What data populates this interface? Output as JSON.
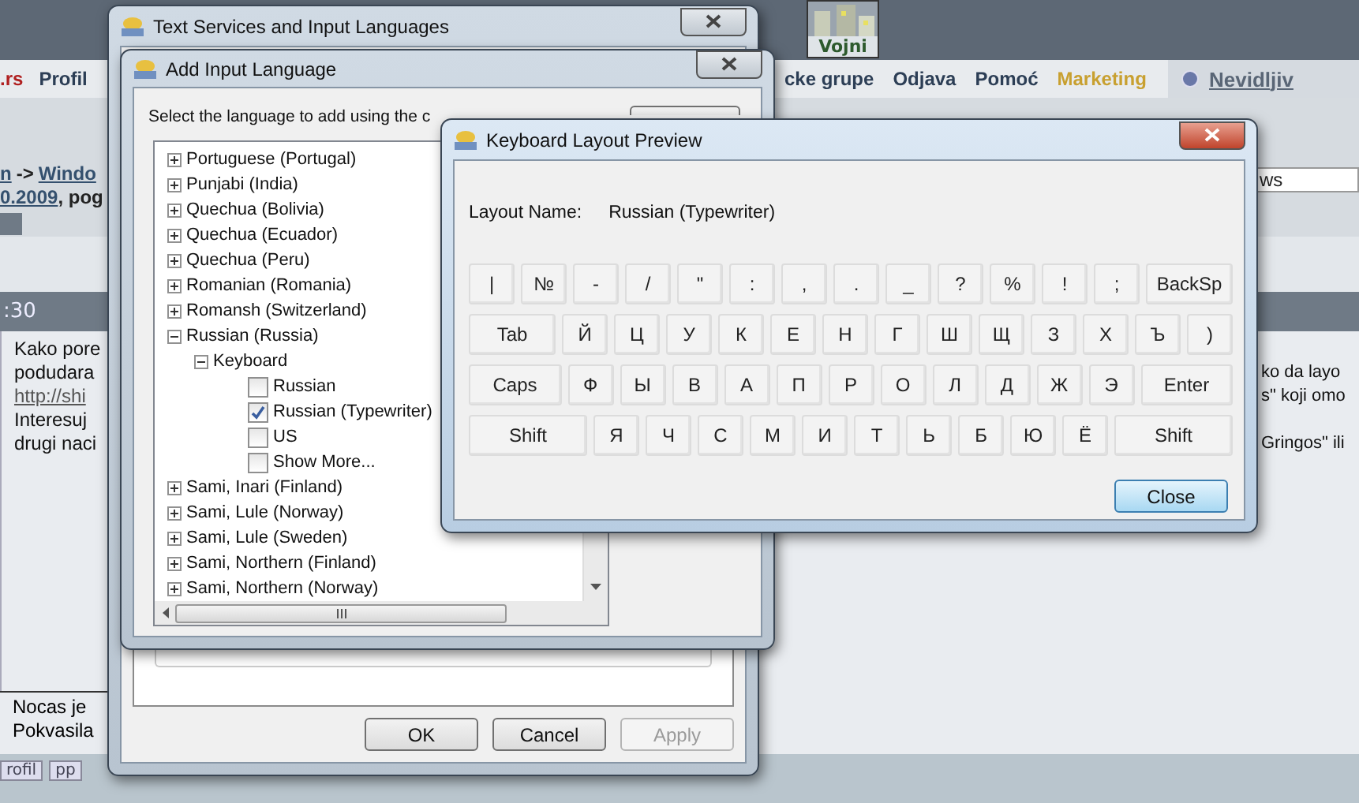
{
  "background_page": {
    "top_tab": {
      "label": "Vojni"
    },
    "nav": [
      {
        "label": ".rs",
        "kind": "brand"
      },
      {
        "label": "Profil",
        "kind": "link"
      },
      {
        "label": "cke grupe",
        "kind": "link"
      },
      {
        "label": "Odjava",
        "kind": "link"
      },
      {
        "label": "Pomoć",
        "kind": "link"
      },
      {
        "label": "Marketing",
        "kind": "highlight"
      }
    ],
    "user_status": "Nevidljiv",
    "breadcrumb": [
      {
        "text": "n",
        "kind": "link"
      },
      {
        "text": "->",
        "kind": "text"
      },
      {
        "text": "Windo",
        "kind": "link"
      }
    ],
    "date_line": [
      {
        "text": "0.2009",
        "kind": "link"
      },
      {
        "text": ", pog",
        "kind": "text"
      }
    ],
    "search_value": "ws",
    "post_time": ":30",
    "post_left": [
      {
        "text": "Kako pore",
        "kind": "text"
      },
      {
        "text": "podudara",
        "kind": "text"
      },
      {
        "text": "http://shi",
        "kind": "link"
      },
      {
        "text": "Interesuj",
        "kind": "text"
      },
      {
        "text": "drugi naci",
        "kind": "text"
      }
    ],
    "post_right_paragraphs": [
      [
        "ko da layo",
        "s\" koji omo"
      ],
      [
        "Gringos\" ili"
      ]
    ],
    "signature": [
      "Nocas je",
      "Pokvasila"
    ],
    "footer_buttons": [
      "rofil",
      "pp"
    ]
  },
  "text_services": {
    "title": "Text Services and Input Languages",
    "active": false,
    "buttons": [
      {
        "label": "OK",
        "disabled": false
      },
      {
        "label": "Cancel",
        "disabled": false
      },
      {
        "label": "Apply",
        "disabled": true
      }
    ]
  },
  "add_input_language": {
    "title": "Add Input Language",
    "active": false,
    "prompt": "Select the language to add using the c",
    "tree": [
      {
        "label": "Portuguese (Portugal)",
        "expanded": false
      },
      {
        "label": "Punjabi (India)",
        "expanded": false
      },
      {
        "label": "Quechua (Bolivia)",
        "expanded": false
      },
      {
        "label": "Quechua (Ecuador)",
        "expanded": false
      },
      {
        "label": "Quechua (Peru)",
        "expanded": false
      },
      {
        "label": "Romanian (Romania)",
        "expanded": false
      },
      {
        "label": "Romansh (Switzerland)",
        "expanded": false
      },
      {
        "label": "Russian (Russia)",
        "expanded": true,
        "children": [
          {
            "label": "Keyboard",
            "expanded": true,
            "children": [
              {
                "label": "Russian",
                "kind": "checkbox",
                "checked": false
              },
              {
                "label": "Russian (Typewriter)",
                "kind": "checkbox",
                "checked": true
              },
              {
                "label": "US",
                "kind": "checkbox",
                "checked": false
              },
              {
                "label": "Show More...",
                "kind": "checkbox",
                "checked": false
              }
            ]
          }
        ]
      },
      {
        "label": "Sami, Inari (Finland)",
        "expanded": false
      },
      {
        "label": "Sami, Lule (Norway)",
        "expanded": false
      },
      {
        "label": "Sami, Lule (Sweden)",
        "expanded": false
      },
      {
        "label": "Sami, Northern (Finland)",
        "expanded": false
      },
      {
        "label": "Sami, Northern (Norway)",
        "expanded": false
      }
    ]
  },
  "keyboard_preview": {
    "title": "Keyboard Layout Preview",
    "active": true,
    "layout_label": "Layout Name:",
    "layout_name": "Russian (Typewriter)",
    "rows": [
      {
        "keys": [
          {
            "label": "|",
            "kind": "char"
          },
          {
            "label": "№",
            "kind": "char"
          },
          {
            "label": "-",
            "kind": "char"
          },
          {
            "label": "/",
            "kind": "char"
          },
          {
            "label": "\"",
            "kind": "char"
          },
          {
            "label": ":",
            "kind": "char"
          },
          {
            "label": ",",
            "kind": "char"
          },
          {
            "label": ".",
            "kind": "char"
          },
          {
            "label": "_",
            "kind": "char"
          },
          {
            "label": "?",
            "kind": "char"
          },
          {
            "label": "%",
            "kind": "char"
          },
          {
            "label": "!",
            "kind": "char"
          },
          {
            "label": ";",
            "kind": "char"
          },
          {
            "label": "BackSp",
            "kind": "modifier"
          }
        ]
      },
      {
        "keys": [
          {
            "label": "Tab",
            "kind": "modifier"
          },
          {
            "label": "Й",
            "kind": "char"
          },
          {
            "label": "Ц",
            "kind": "char"
          },
          {
            "label": "У",
            "kind": "char"
          },
          {
            "label": "К",
            "kind": "char"
          },
          {
            "label": "Е",
            "kind": "char"
          },
          {
            "label": "Н",
            "kind": "char"
          },
          {
            "label": "Г",
            "kind": "char"
          },
          {
            "label": "Ш",
            "kind": "char"
          },
          {
            "label": "Щ",
            "kind": "char"
          },
          {
            "label": "З",
            "kind": "char"
          },
          {
            "label": "Х",
            "kind": "char"
          },
          {
            "label": "Ъ",
            "kind": "char"
          },
          {
            "label": ")",
            "kind": "char"
          }
        ]
      },
      {
        "keys": [
          {
            "label": "Caps",
            "kind": "modifier"
          },
          {
            "label": "Ф",
            "kind": "char"
          },
          {
            "label": "Ы",
            "kind": "char"
          },
          {
            "label": "В",
            "kind": "char"
          },
          {
            "label": "А",
            "kind": "char"
          },
          {
            "label": "П",
            "kind": "char"
          },
          {
            "label": "Р",
            "kind": "char"
          },
          {
            "label": "О",
            "kind": "char"
          },
          {
            "label": "Л",
            "kind": "char"
          },
          {
            "label": "Д",
            "kind": "char"
          },
          {
            "label": "Ж",
            "kind": "char"
          },
          {
            "label": "Э",
            "kind": "char"
          },
          {
            "label": "Enter",
            "kind": "modifier"
          }
        ]
      },
      {
        "keys": [
          {
            "label": "Shift",
            "kind": "modifier"
          },
          {
            "label": "Я",
            "kind": "char"
          },
          {
            "label": "Ч",
            "kind": "char"
          },
          {
            "label": "С",
            "kind": "char"
          },
          {
            "label": "М",
            "kind": "char"
          },
          {
            "label": "И",
            "kind": "char"
          },
          {
            "label": "Т",
            "kind": "char"
          },
          {
            "label": "Ь",
            "kind": "char"
          },
          {
            "label": "Б",
            "kind": "char"
          },
          {
            "label": "Ю",
            "kind": "char"
          },
          {
            "label": "Ё",
            "kind": "char"
          },
          {
            "label": "Shift",
            "kind": "modifier"
          }
        ]
      }
    ],
    "close_button": {
      "label": "Close",
      "default": true
    }
  }
}
